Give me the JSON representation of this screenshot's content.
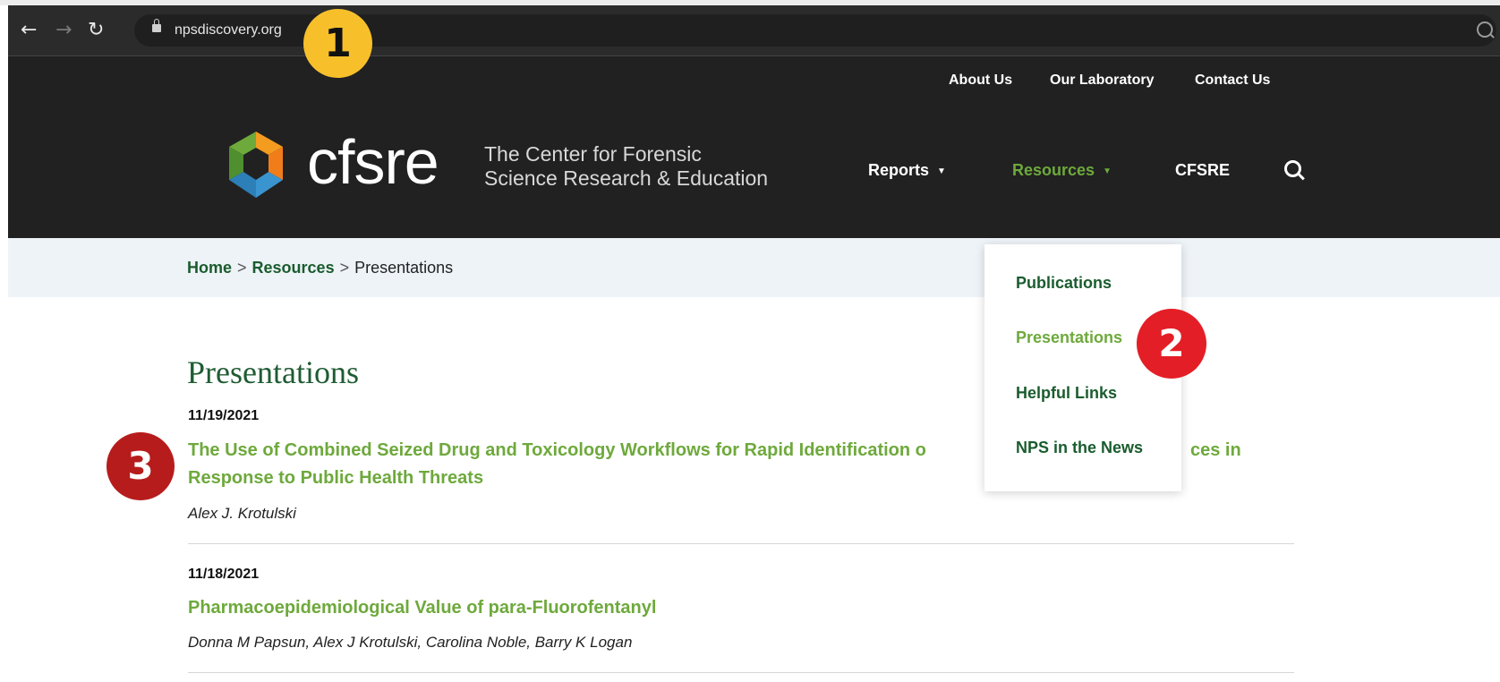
{
  "browser": {
    "back_icon": "back-arrow-icon",
    "forward_icon": "forward-arrow-icon",
    "reload_icon": "reload-icon",
    "url": "npsdiscovery.org"
  },
  "header": {
    "util_links": [
      "About Us",
      "Our Laboratory",
      "Contact Us"
    ],
    "logo_text": "cfsre",
    "tagline_line1": "The Center for Forensic",
    "tagline_line2": "Science Research & Education",
    "nav": [
      {
        "label": "Reports",
        "caret": "▼"
      },
      {
        "label": "Resources",
        "caret": "▼"
      },
      {
        "label": "CFSRE"
      }
    ]
  },
  "breadcrumb": {
    "home": "Home",
    "resources": "Resources",
    "current": "Presentations",
    "separator": ">"
  },
  "dropdown": {
    "items": [
      "Publications",
      "Presentations",
      "Helpful Links",
      "NPS in the News"
    ]
  },
  "main": {
    "title": "Presentations",
    "presentations": [
      {
        "date": "11/19/2021",
        "title_line1": "The Use of Combined Seized Drug and Toxicology Workflows for Rapid Identification o",
        "title_line1_end": "ces in",
        "title_line2": "Response to Public Health Threats",
        "authors": "Alex J. Krotulski"
      },
      {
        "date": "11/18/2021",
        "title": "Pharmacoepidemiological Value of para-Fluorofentanyl",
        "authors": "Donna M Papsun, Alex J Krotulski, Carolina Noble, Barry K Logan"
      }
    ]
  },
  "annotations": [
    "1",
    "2",
    "3"
  ],
  "colors": {
    "header_bg": "#212121",
    "accent_green": "#6ea93c",
    "dark_green": "#1a5c2e",
    "badge_yellow": "#f7c02b",
    "badge_red": "#e41e26",
    "badge_dark_red": "#b71c1c"
  }
}
